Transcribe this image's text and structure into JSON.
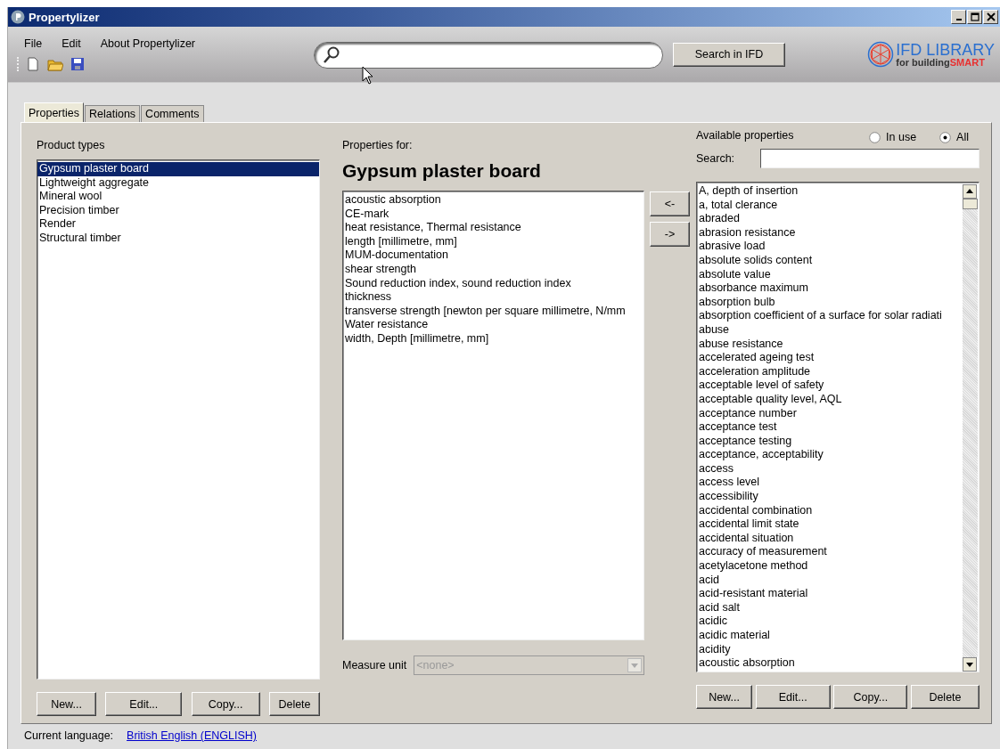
{
  "window": {
    "title": "Propertylizer"
  },
  "menu": [
    "File",
    "Edit",
    "About Propertylizer"
  ],
  "search": {
    "button": "Search in IFD"
  },
  "logo": {
    "title": "IFD LIBRARY",
    "subtitle": "for building",
    "subtitle_accent": "SMART"
  },
  "tabs": [
    {
      "label": "Properties",
      "selected": true
    },
    {
      "label": "Relations",
      "selected": false
    },
    {
      "label": "Comments",
      "selected": false
    }
  ],
  "product_types": {
    "label": "Product types",
    "items": [
      {
        "label": "Gypsum plaster board",
        "selected": true
      },
      {
        "label": "Lightweight aggregate",
        "selected": false
      },
      {
        "label": "Mineral wool",
        "selected": false
      },
      {
        "label": "Precision timber",
        "selected": false
      },
      {
        "label": "Render",
        "selected": false
      },
      {
        "label": "Structural timber",
        "selected": false
      }
    ],
    "buttons": [
      "New...",
      "Edit...",
      "Copy...",
      "Delete"
    ]
  },
  "properties": {
    "label": "Properties for:",
    "heading": "Gypsum plaster board",
    "items": [
      "acoustic absorption",
      "CE-mark",
      "heat resistance, Thermal resistance",
      "length [millimetre, mm]",
      "MUM-documentation",
      "shear strength",
      "Sound reduction index, sound reduction index",
      "thickness",
      "transverse strength [newton per square millimetre, N/mm",
      "Water resistance",
      "width, Depth [millimetre, mm]"
    ],
    "measure_unit": {
      "label": "Measure unit",
      "value": "<none>",
      "disabled": true
    }
  },
  "move_buttons": [
    "<-",
    "->"
  ],
  "available": {
    "label": "Available properties",
    "filters": [
      {
        "label": "In use",
        "selected": false
      },
      {
        "label": "All",
        "selected": true
      }
    ],
    "search_label": "Search:",
    "items": [
      "A, depth of insertion",
      "a, total clerance",
      "abraded",
      "abrasion resistance",
      "abrasive load",
      "absolute solids content",
      "absolute value",
      "absorbance maximum",
      "absorption bulb",
      "absorption coefficient of a surface for solar radiati",
      "abuse",
      "abuse resistance",
      "accelerated ageing test",
      "acceleration amplitude",
      "acceptable level of safety",
      "acceptable quality level, AQL",
      "acceptance number",
      "acceptance test",
      "acceptance testing",
      "acceptance, acceptability",
      "access",
      "access level",
      "accessibility",
      "accidental combination",
      "accidental limit state",
      "accidental situation",
      "accuracy of measurement",
      "acetylacetone method",
      "acid",
      "acid-resistant material",
      "acid salt",
      "acidic",
      "acidic material",
      "acidity",
      "acoustic absorption"
    ],
    "buttons": [
      "New...",
      "Edit...",
      "Copy...",
      "Delete"
    ]
  },
  "status_bar": {
    "label": "Current language:",
    "link": "British English (ENGLISH)"
  }
}
